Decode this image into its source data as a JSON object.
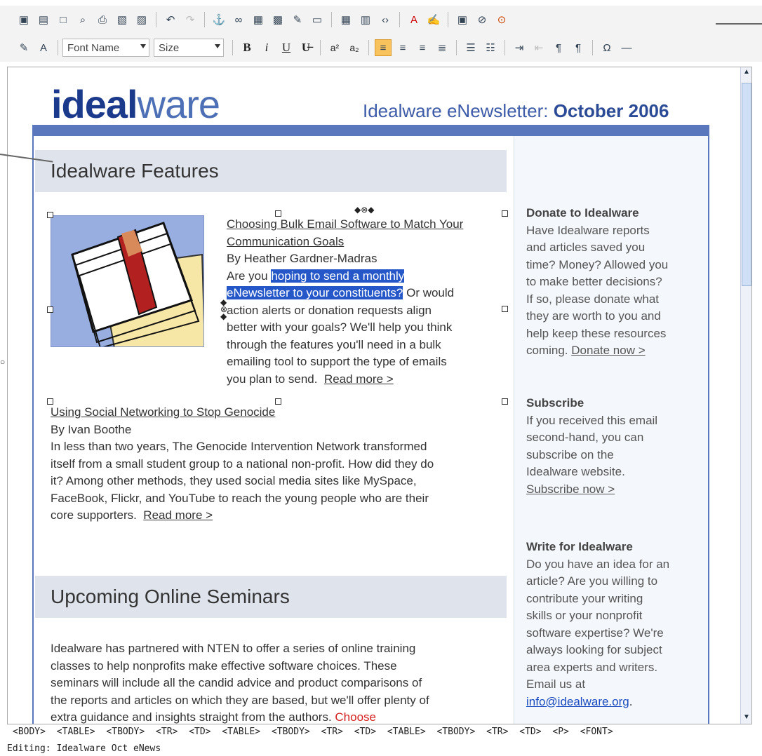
{
  "toolbar": {
    "font_name": "Font Name",
    "size": "Size",
    "bold": "B",
    "italic": "i",
    "underline": "U",
    "strike": "U̶",
    "superscript": "a²",
    "subscript": "a₂"
  },
  "brand": {
    "logo_bold": "ideal",
    "logo_light": "ware",
    "masthead_prefix": "Idealware eNewsletter:",
    "masthead_bold": "October 2006"
  },
  "features": {
    "header": "Idealware Features",
    "article1": {
      "title_line1": "Choosing Bulk Email Software to Match Your",
      "title_line2": "Communication Goals",
      "byline": "By Heather Gardner-Madras",
      "lead": "Are you",
      "selected_a": "hoping to send a monthly",
      "selected_b": "eNewsletter to your constituents?",
      "after_sel": "Or would",
      "body": [
        "action alerts or donation requests align",
        "better with your goals? We'll help you think",
        "through the features you'll need in a bulk",
        "emailing tool to support the type of emails",
        "you plan to send."
      ],
      "read_more": "Read more >"
    },
    "article2": {
      "title": "Using Social Networking to Stop Genocide",
      "byline": "By Ivan Boothe",
      "body": [
        "In less than two years, The Genocide Intervention Network transformed",
        "itself from a small student group to a national non-profit. How did they do",
        "it? Among other methods, they used social media sites like MySpace,",
        "FaceBook, Flickr, and YouTube to reach the young people who are their",
        "core supporters."
      ],
      "read_more": "Read more >"
    }
  },
  "seminars": {
    "header": "Upcoming Online Seminars",
    "body": [
      "Idealware has partnered with NTEN to offer a series of online training",
      "classes to help nonprofits make effective software choices. These",
      "seminars will include all the candid advice and product comparisons of",
      "the reports and articles on which they are based, but we'll offer plenty of",
      "extra guidance and insights straight from the authors."
    ],
    "cta": "Choose"
  },
  "sidebar": {
    "donate": {
      "title": "Donate to Idealware",
      "body": [
        "Have Idealware reports",
        "and articles saved you",
        "time? Money? Allowed you",
        "to make better decisions?",
        "If so, please donate what",
        "they are worth to you and",
        "help keep these resources",
        "coming."
      ],
      "link": "Donate now >"
    },
    "subscribe": {
      "title": "Subscribe",
      "body": [
        "If you received this email",
        "second-hand, you can",
        "subscribe on the",
        "Idealware website."
      ],
      "link": "Subscribe now >"
    },
    "write": {
      "title": "Write for Idealware",
      "body": [
        "Do you have an idea for an",
        "article? Are you willing to",
        "contribute your writing",
        "skills or your nonprofit",
        "software expertise? We're",
        "always looking for subject",
        "area experts and writers.",
        "Email us at"
      ],
      "email": "info@idealware.org",
      "period": "."
    }
  },
  "pathbar": {
    "items": [
      "<BODY>",
      "<TABLE>",
      "<TBODY>",
      "<TR>",
      "<TD>",
      "<TABLE>",
      "<TBODY>",
      "<TR>",
      "<TD>",
      "<TABLE>",
      "<TBODY>",
      "<TR>",
      "<TD>",
      "<P>",
      "<FONT>"
    ]
  },
  "status": {
    "text": "Editing: Idealware Oct eNews"
  },
  "colors": {
    "accent": "#5a76bc",
    "selection": "#2557c8",
    "active_button": "#f8c35c",
    "cta_red": "#d62020"
  }
}
